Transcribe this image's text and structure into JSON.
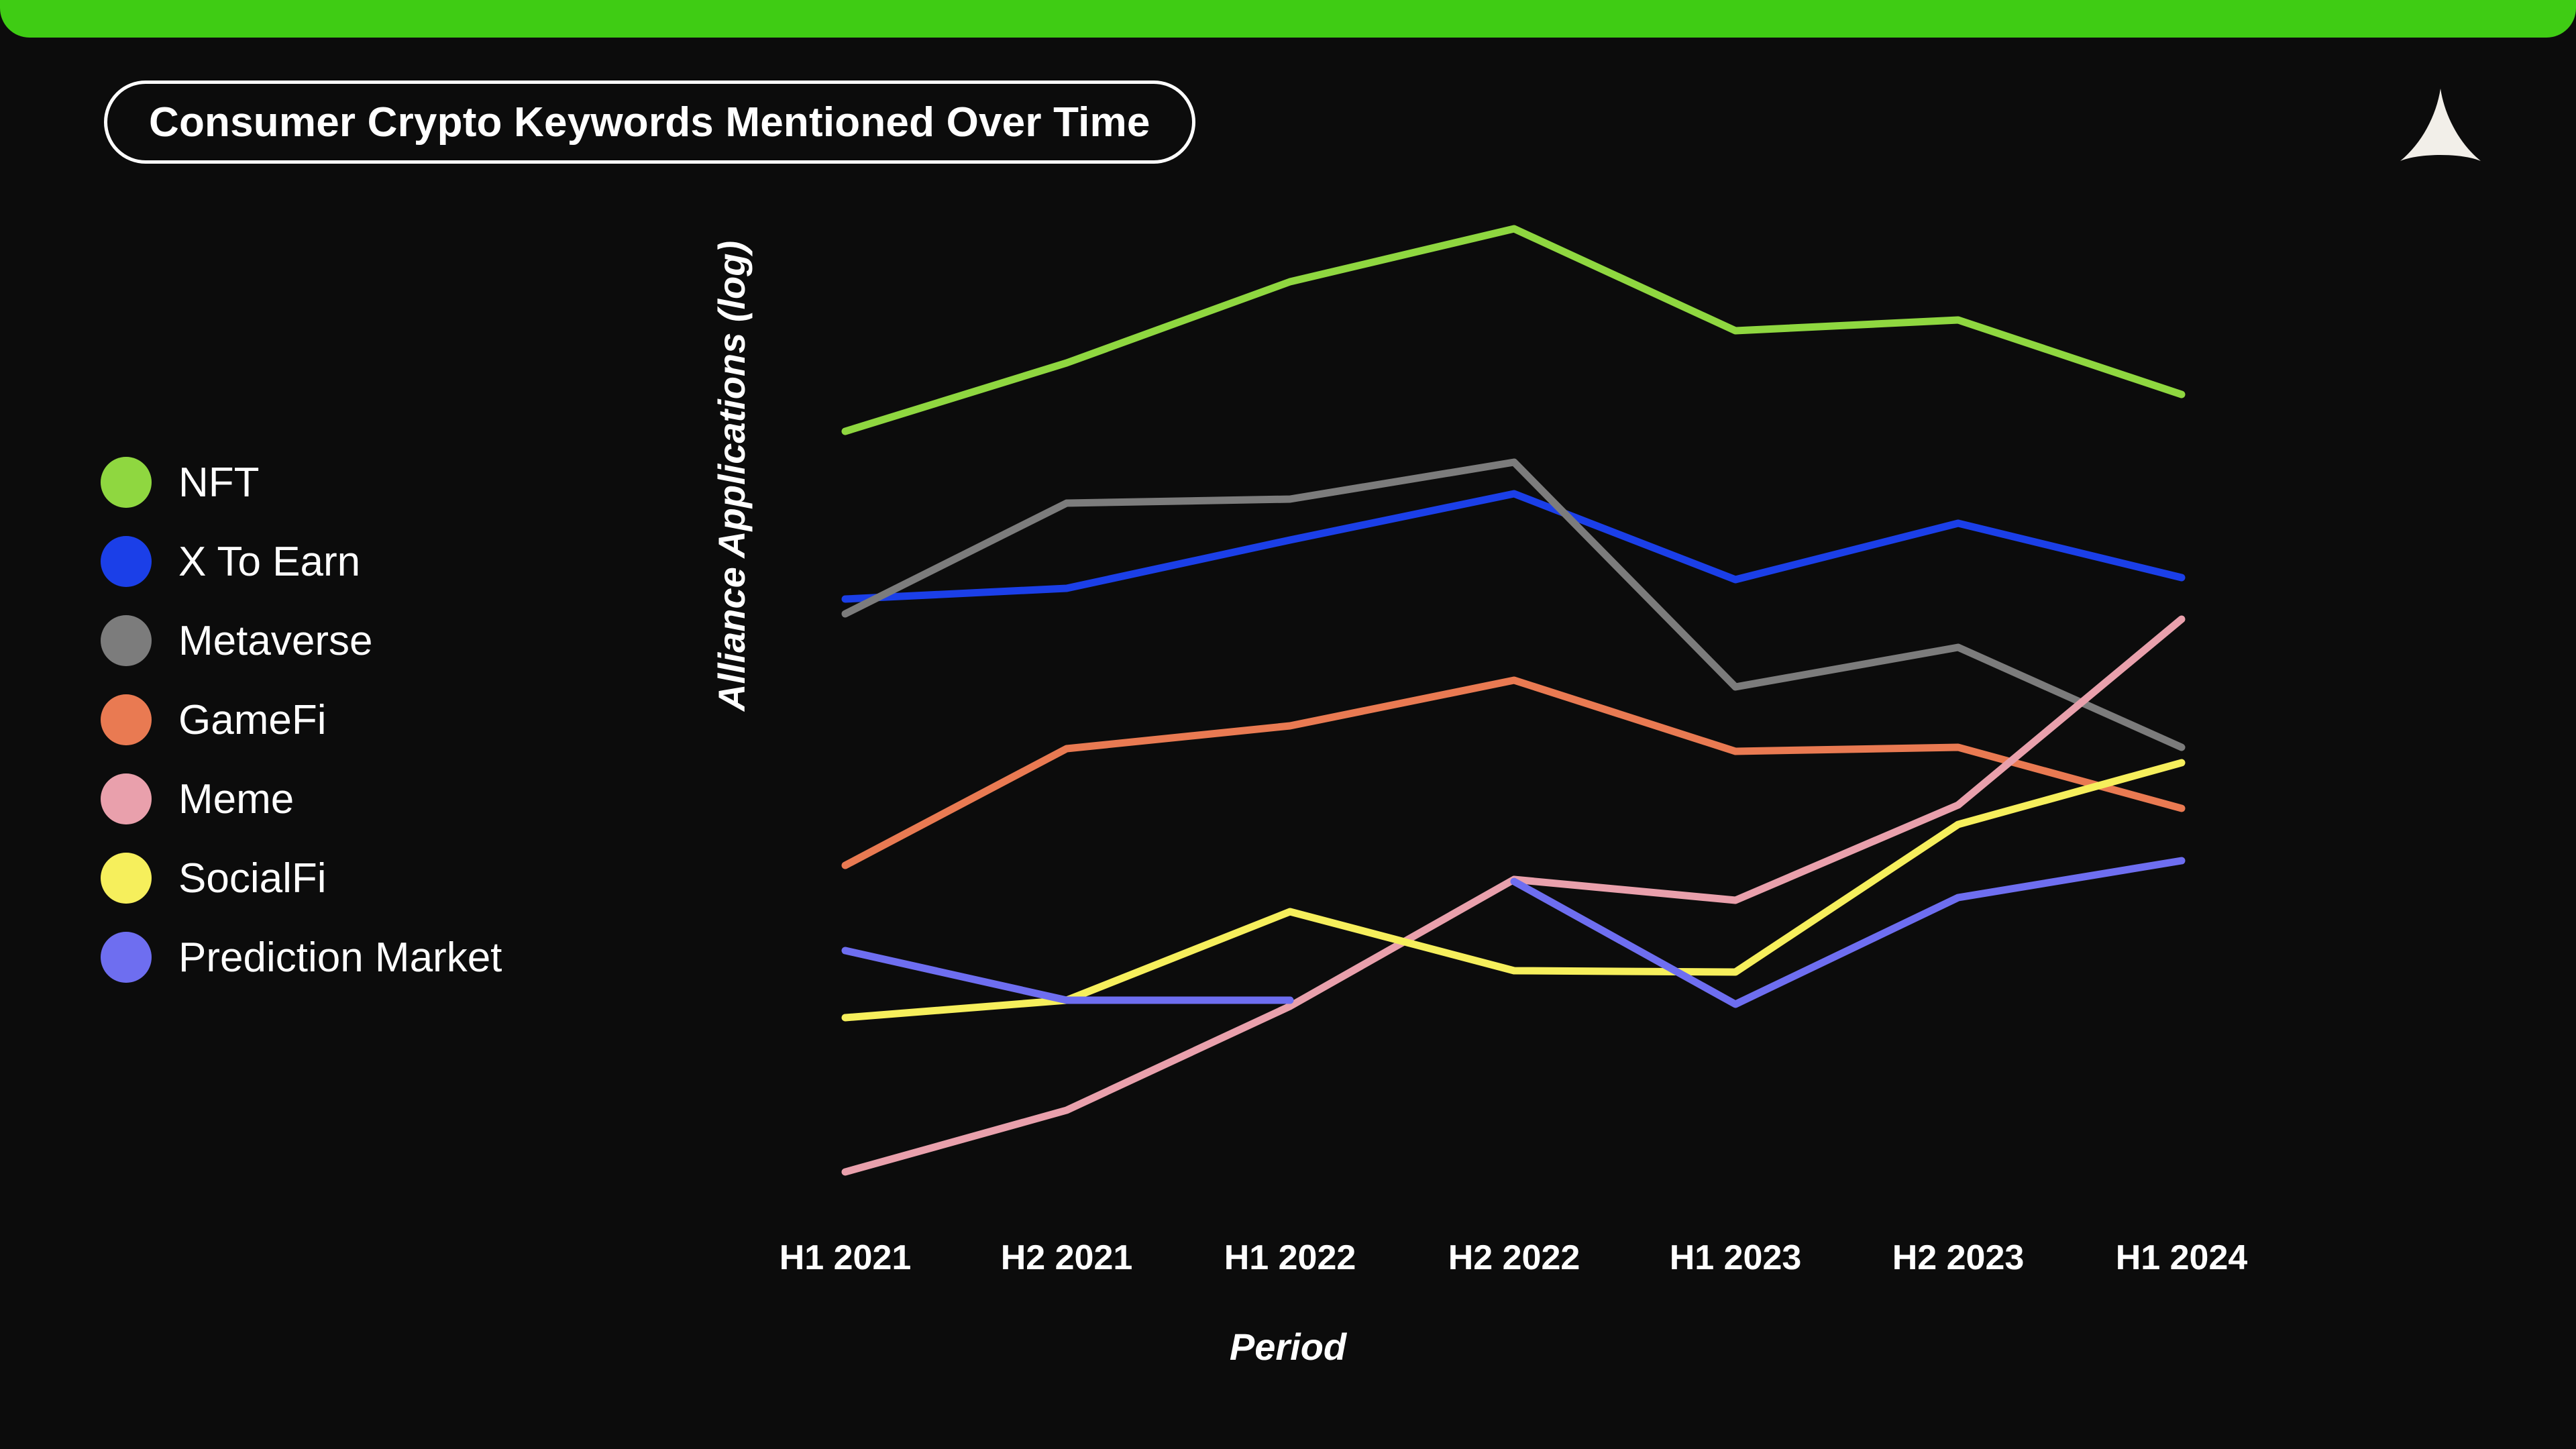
{
  "top_bar": {
    "color": "#3fcc14"
  },
  "header": {
    "title": "Consumer Crypto Keywords Mentioned Over Time",
    "logo_icon": "alliance-arrowhead-logo",
    "logo_color": "#f2efe9"
  },
  "background_color": "#0c0c0c",
  "legend": {
    "items": [
      {
        "label": "NFT",
        "color": "#8fd740"
      },
      {
        "label": "X To Earn",
        "color": "#1b3fe8"
      },
      {
        "label": "Metaverse",
        "color": "#7c7c7c"
      },
      {
        "label": "GameFi",
        "color": "#e97a52"
      },
      {
        "label": "Meme",
        "color": "#e9a0ac"
      },
      {
        "label": "SocialFi",
        "color": "#f6ef5c"
      },
      {
        "label": "Prediction Market",
        "color": "#6e6ef0"
      }
    ]
  },
  "chart_data": {
    "type": "line",
    "title": "Consumer Crypto Keywords Mentioned Over Time",
    "xlabel": "Period",
    "ylabel": "Alliance Applications (log)",
    "grid": false,
    "legend_position": "left",
    "y_scale": "log",
    "y_axis_ticks_shown": false,
    "categories": [
      "H1 2021",
      "H2 2021",
      "H1 2022",
      "H2 2022",
      "H1 2023",
      "H2 2023",
      "H1 2024"
    ],
    "series": [
      {
        "name": "NFT",
        "color": "#8fd740",
        "values": [
          35,
          58,
          98,
          125,
          70,
          76,
          50
        ]
      },
      {
        "name": "X To Earn",
        "color": "#1b3fe8",
        "values": [
          12,
          13,
          18,
          24,
          14,
          20,
          14
        ]
      },
      {
        "name": "Metaverse",
        "color": "#7c7c7c",
        "values": [
          11,
          22,
          23,
          28,
          9,
          11,
          6
        ]
      },
      {
        "name": "GameFi",
        "color": "#e97a52",
        "values": [
          2.6,
          5.5,
          6.2,
          7.6,
          5.4,
          5.5,
          4.2
        ]
      },
      {
        "name": "Meme",
        "color": "#e9a0ac",
        "values": [
          0.45,
          0.6,
          1.1,
          2.4,
          2.2,
          3.6,
          9.5
        ]
      },
      {
        "name": "SocialFi",
        "color": "#f6ef5c",
        "values": [
          1.0,
          1.1,
          1.9,
          1.4,
          1.4,
          3.3,
          4.5
        ]
      },
      {
        "name": "Prediction Market",
        "color": "#6e6ef0",
        "values": [
          1.5,
          1.1,
          1.1,
          2.4,
          1.1,
          2.5,
          3.0
        ]
      }
    ],
    "plot_pixel_geometry": {
      "x_positions": [
        1260,
        1590,
        1923,
        2257,
        2587,
        2919,
        3252
      ],
      "series_pixel_y": {
        "NFT": [
          643,
          541,
          420,
          341,
          493,
          477,
          588
        ],
        "X To Earn": [
          893,
          877,
          805,
          736,
          864,
          780,
          861
        ],
        "Metaverse": [
          915,
          750,
          744,
          689,
          1024,
          965,
          1114
        ],
        "GameFi": [
          1290,
          1116,
          1082,
          1014,
          1120,
          1114,
          1205
        ],
        "Meme": [
          1747,
          1655,
          1500,
          1311,
          1342,
          1200,
          923
        ],
        "SocialFi": [
          1517,
          1491,
          1359,
          1447,
          1449,
          1229,
          1137
        ],
        "Prediction Market": [
          1417,
          1491,
          1491,
          1314,
          1497,
          1338,
          1283
        ]
      },
      "prediction_market_truncated_after_index": 2
    }
  }
}
